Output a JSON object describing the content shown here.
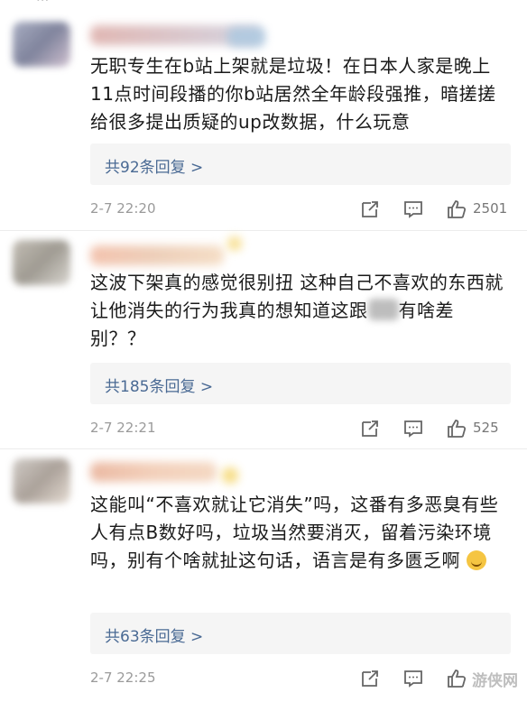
{
  "top_cut_text": "                      ···",
  "comments": [
    {
      "text": "无职专生在b站上架就是垃圾！在日本人家是晚上11点时间段播的你b站居然全年龄段强推，暗搓搓给很多提出质疑的up改数据，什么玩意",
      "reply_label": "共92条回复 >",
      "time": "2-7 22:20",
      "likes": "2501"
    },
    {
      "text_a": "这波下架真的感觉很别扭 这种自己不喜欢的东西就让他消失的行为我真的想知道这跟",
      "text_b": "有啥差别？？",
      "reply_label": "共185条回复 >",
      "time": "2-7 22:21",
      "likes": "525"
    },
    {
      "text": "这能叫“不喜欢就让它消失”吗，这番有多恶臭有些人有点B数好吗，垃圾当然要消灭，留着污染环境吗，别有个啥就扯这句话，语言是有多匮乏啊",
      "reply_label": "共63条回复 >",
      "time": "2-7 22:25",
      "likes": ""
    }
  ],
  "watermark": "游侠网",
  "icons": [
    "share-icon",
    "comment-icon",
    "like-icon"
  ]
}
